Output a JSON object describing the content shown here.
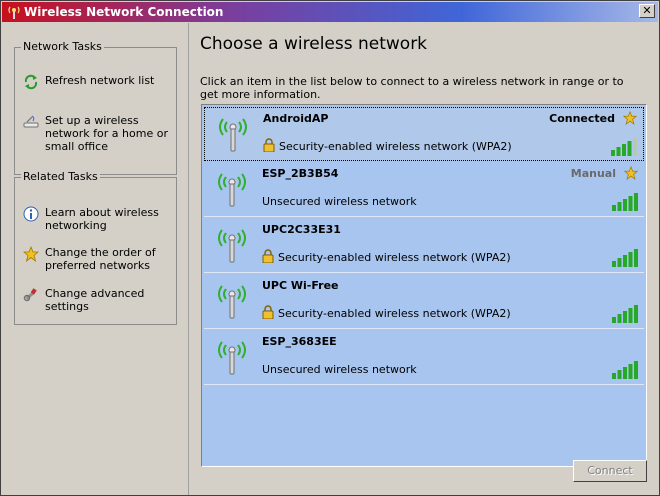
{
  "window": {
    "title": "Wireless Network Connection",
    "close_glyph": "✕"
  },
  "sidebar": {
    "network_tasks": {
      "title": "Network Tasks",
      "items": [
        {
          "label": "Refresh network list",
          "icon": "refresh-icon"
        },
        {
          "label": "Set up a wireless network for a home or small office",
          "icon": "setup-network-icon"
        }
      ]
    },
    "related_tasks": {
      "title": "Related Tasks",
      "items": [
        {
          "label": "Learn about wireless networking",
          "icon": "info-icon"
        },
        {
          "label": "Change the order of preferred networks",
          "icon": "star-icon"
        },
        {
          "label": "Change advanced settings",
          "icon": "settings-icon"
        }
      ]
    }
  },
  "main": {
    "title": "Choose a wireless network",
    "instructions": "Click an item in the list below to connect to a wireless network in range or to get more information.",
    "networks": [
      {
        "name": "AndroidAP",
        "status": "Connected",
        "security": "Security-enabled wireless network (WPA2)",
        "secured": true,
        "starred": true,
        "signal_bars": 4,
        "selected": true
      },
      {
        "name": "ESP_2B3B54",
        "status": "Manual",
        "security": "Unsecured wireless network",
        "secured": false,
        "starred": true,
        "signal_bars": 5
      },
      {
        "name": "UPC2C33E31",
        "status": "",
        "security": "Security-enabled wireless network (WPA2)",
        "secured": true,
        "starred": false,
        "signal_bars": 5
      },
      {
        "name": "UPC Wi-Free",
        "status": "",
        "security": "Security-enabled wireless network (WPA2)",
        "secured": true,
        "starred": false,
        "signal_bars": 5
      },
      {
        "name": "ESP_3683EE",
        "status": "",
        "security": "Unsecured wireless network",
        "secured": false,
        "starred": false,
        "signal_bars": 5
      }
    ],
    "connect_label": "Connect"
  },
  "colors": {
    "list_bg": "#a8c5f0",
    "signal_on": "#28a828",
    "signal_off": "#b8c8b8",
    "star": "#f0c020"
  }
}
